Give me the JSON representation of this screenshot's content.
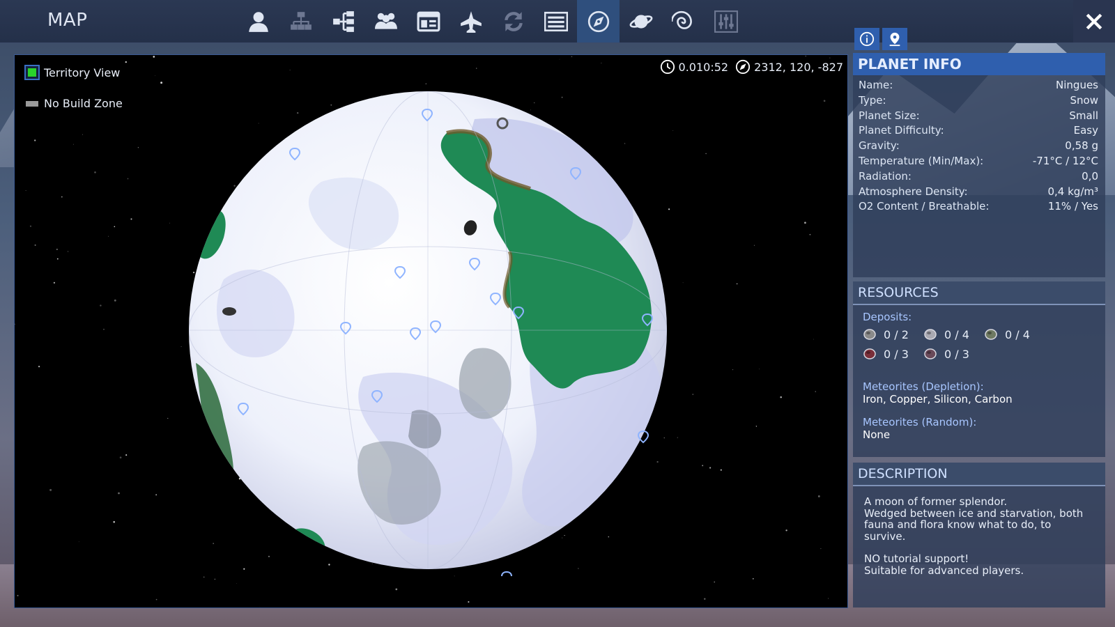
{
  "header": {
    "title": "MAP",
    "nav_icons": [
      "player-icon",
      "factions-icon",
      "structure-tree-icon",
      "group-icon",
      "window-icon",
      "ship-icon",
      "swap-icon",
      "list-icon",
      "compass-icon",
      "planet-icon",
      "galaxy-icon",
      "settings-sliders-icon"
    ],
    "active_icon": "compass-icon"
  },
  "map": {
    "legend": {
      "territory_view": "Territory View",
      "no_build_zone": "No Build Zone"
    },
    "time": "0.010:52",
    "position": "2312, 120, -827"
  },
  "planet_info": {
    "title": "PLANET INFO",
    "rows": [
      {
        "label": "Name:",
        "value": "Ningues"
      },
      {
        "label": "Type:",
        "value": "Snow"
      },
      {
        "label": "Planet Size:",
        "value": "Small"
      },
      {
        "label": "Planet Difficulty:",
        "value": "Easy"
      },
      {
        "label": "Gravity:",
        "value": "0,58 g"
      },
      {
        "label": "Temperature (Min/Max):",
        "value": "-71°C / 12°C"
      },
      {
        "label": "Radiation:",
        "value": "0,0"
      },
      {
        "label": "Atmosphere Density:",
        "value": "0,4 kg/m³"
      },
      {
        "label": "O2 Content / Breathable:",
        "value": "11% / Yes"
      }
    ]
  },
  "resources": {
    "title": "RESOURCES",
    "deposits_label": "Deposits:",
    "deposits": [
      {
        "icon": "ore-gray-icon",
        "count": "0 / 2",
        "color": "#8a8a8a"
      },
      {
        "icon": "ore-silver-icon",
        "count": "0 / 4",
        "color": "#a9a9b2"
      },
      {
        "icon": "ore-green-icon",
        "count": "0 / 4",
        "color": "#6f7a62"
      },
      {
        "icon": "ore-red-icon",
        "count": "0 / 3",
        "color": "#7a2f3a"
      },
      {
        "icon": "ore-mauve-icon",
        "count": "0 / 3",
        "color": "#6a4a5a"
      }
    ],
    "meteor_depletion_label": "Meteorites (Depletion):",
    "meteor_depletion_value": "Iron, Copper, Silicon, Carbon",
    "meteor_random_label": "Meteorites (Random):",
    "meteor_random_value": "None"
  },
  "description": {
    "title": "DESCRIPTION",
    "line1": "A moon of former splendor.",
    "line2": "Wedged between ice and starvation, both fauna and flora know what to do, to survive.",
    "line3": "NO tutorial support!",
    "line4": "Suitable for advanced players."
  },
  "colors": {
    "accent": "#2f5fae",
    "territory": "#1f8a55",
    "snow": "#f2f4fb"
  }
}
